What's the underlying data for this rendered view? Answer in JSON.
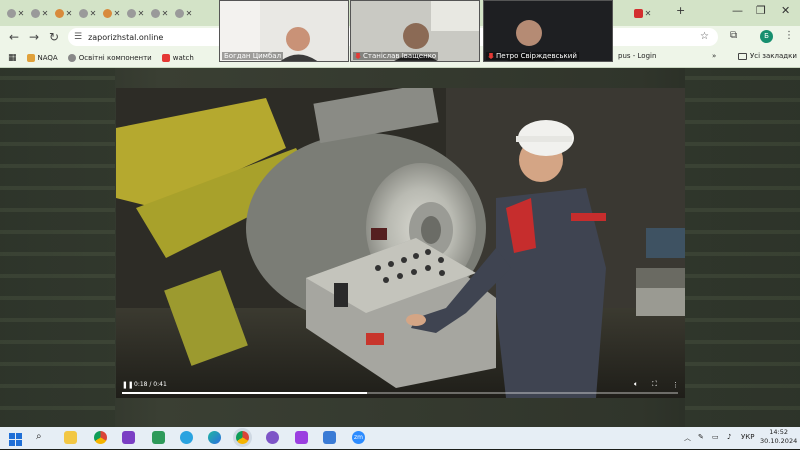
{
  "browser": {
    "url": "zaporizhstal.online",
    "tabs": [
      {
        "icon": "globe-icon"
      },
      {
        "icon": "globe-icon"
      },
      {
        "icon": "globe-icon"
      },
      {
        "icon": "globe-icon"
      },
      {
        "icon": "globe-icon"
      },
      {
        "icon": "globe-icon"
      },
      {
        "icon": "globe-icon"
      },
      {
        "icon": "globe-icon"
      }
    ],
    "new_tab_label": "+",
    "bookmarks": [
      {
        "label": "NAQA",
        "color": "#e0a13a"
      },
      {
        "label": "Освітні компоненти",
        "color": "#888888"
      },
      {
        "label": "watch",
        "color": "#e53935"
      }
    ],
    "bookmarks_hidden_label": "pus - Login",
    "bookmarks_more": "»",
    "all_bookmarks_label": "Усі закладки",
    "profile_initial": "Б"
  },
  "participants": [
    {
      "name": "Богдан Цимбал",
      "mic_muted": false
    },
    {
      "name": "Станіслав Іващенко",
      "mic_muted": true
    },
    {
      "name": "Петро Свірждевський",
      "mic_muted": true
    }
  ],
  "video": {
    "current_time": "0:18",
    "duration": "0:41",
    "time_text": "0:18 / 0:41",
    "progress": 0.44
  },
  "taskbar": {
    "apps": [
      "windows",
      "search",
      "files",
      "chrome",
      "media",
      "downloads",
      "telegram",
      "edge",
      "chrome2",
      "viber",
      "purple",
      "docs",
      "zoom"
    ],
    "tray": {
      "lang": "УКР"
    },
    "time": "14:52",
    "date": "30.10.2024"
  },
  "colors": {
    "chrome_bg": "#d3e3c7",
    "accent_green": "#178f6f",
    "taskbar_bg": "#e6eef5"
  }
}
